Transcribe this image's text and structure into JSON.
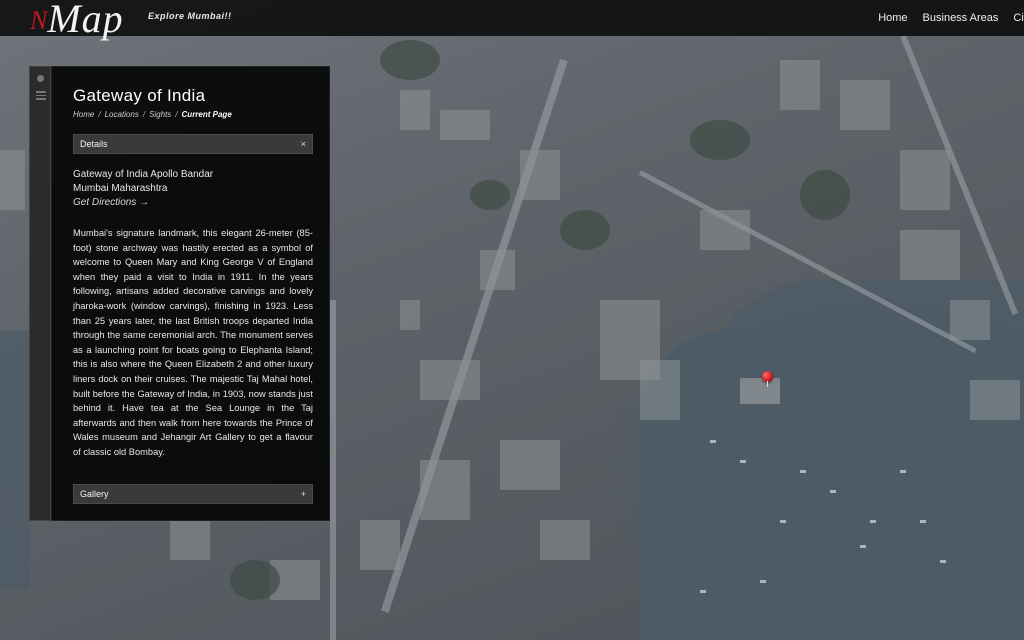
{
  "header": {
    "logo_letter": "N",
    "logo_word": "Map",
    "tagline": "Explore Mumbai!!",
    "nav": [
      {
        "label": "Home"
      },
      {
        "label": "Business Areas"
      },
      {
        "label": "Cine"
      }
    ]
  },
  "panel": {
    "title": "Gateway of India",
    "breadcrumb": [
      {
        "label": "Home"
      },
      {
        "label": "Locations"
      },
      {
        "label": "Sights"
      },
      {
        "label": "Current Page"
      }
    ],
    "details_label": "Details",
    "details_toggle": "×",
    "address_line1": "Gateway of India Apollo Bandar",
    "address_line2": "Mumbai Maharashtra",
    "directions_label": "Get Directions →",
    "description": "Mumbai's signature landmark, this elegant 26-meter (85-foot) stone archway was hastily erected as a symbol of welcome to Queen Mary and King George V of England when they paid a visit to India in 1911. In the years following, artisans added decorative carvings and lovely jharoka-work (window carvings), finishing in 1923. Less than 25 years later, the last British troops departed India through the same ceremonial arch. The monument serves as a launching point for boats going to Elephanta Island; this is also where the Queen Elizabeth 2 and other luxury liners dock on their cruises. The majestic Taj Mahal hotel, built before the Gateway of India, in 1903, now stands just behind it. Have tea at the Sea Lounge in the Taj afterwards and then walk from here towards the Prince of Wales museum and Jehangir Art Gallery to get a flavour of classic old Bombay.",
    "gallery_label": "Gallery",
    "gallery_toggle": "+"
  },
  "map": {
    "marker_icon": "map-pin-icon",
    "marker_color": "#d01515"
  }
}
